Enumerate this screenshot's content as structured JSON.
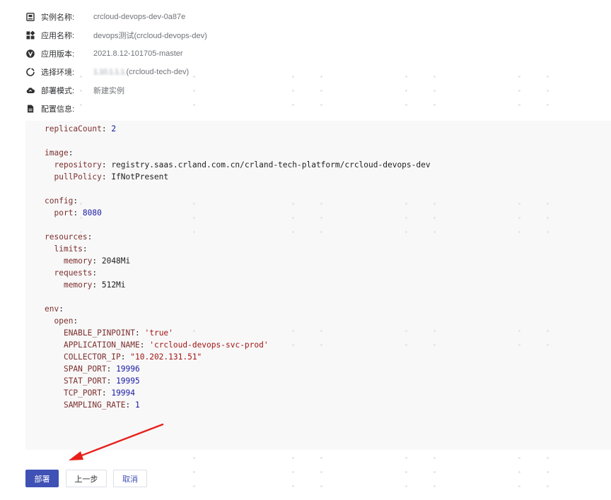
{
  "info": {
    "instance": {
      "label": "实例名称:",
      "value": "crcloud-devops-dev-0a87e",
      "icon": "instance-icon"
    },
    "app": {
      "label": "应用名称:",
      "value": "devops测试(crcloud-devops-dev)",
      "icon": "app-grid-icon"
    },
    "version": {
      "label": "应用版本:",
      "value": "2021.8.12-101705-master",
      "icon": "version-v-icon"
    },
    "env": {
      "label": "选择环境:",
      "value_blurred": "1.10.1.1.1.",
      "value": "(crcloud-tech-dev)",
      "icon": "environment-icon"
    },
    "mode": {
      "label": "部署模式:",
      "value": "新建实例",
      "icon": "cloud-icon"
    },
    "config": {
      "label": "配置信息:",
      "icon": "document-icon"
    }
  },
  "yaml": [
    [
      [
        "k",
        "replicaCount"
      ],
      [
        "p",
        ": "
      ],
      [
        "n",
        "2"
      ]
    ],
    [],
    [
      [
        "k",
        "image"
      ],
      [
        "p",
        ":"
      ]
    ],
    [
      [
        "p",
        "  "
      ],
      [
        "k",
        "repository"
      ],
      [
        "p",
        ": registry.saas.crland.com.cn/crland-tech-platform/crcloud-devops-dev"
      ]
    ],
    [
      [
        "p",
        "  "
      ],
      [
        "k",
        "pullPolicy"
      ],
      [
        "p",
        ": IfNotPresent"
      ]
    ],
    [],
    [
      [
        "k",
        "config"
      ],
      [
        "p",
        ":"
      ]
    ],
    [
      [
        "p",
        "  "
      ],
      [
        "k",
        "port"
      ],
      [
        "p",
        ": "
      ],
      [
        "n",
        "8080"
      ]
    ],
    [],
    [
      [
        "k",
        "resources"
      ],
      [
        "p",
        ":"
      ]
    ],
    [
      [
        "p",
        "  "
      ],
      [
        "k",
        "limits"
      ],
      [
        "p",
        ":"
      ]
    ],
    [
      [
        "p",
        "    "
      ],
      [
        "k",
        "memory"
      ],
      [
        "p",
        ": 2048Mi"
      ]
    ],
    [
      [
        "p",
        "  "
      ],
      [
        "k",
        "requests"
      ],
      [
        "p",
        ":"
      ]
    ],
    [
      [
        "p",
        "    "
      ],
      [
        "k",
        "memory"
      ],
      [
        "p",
        ": 512Mi"
      ]
    ],
    [],
    [
      [
        "k",
        "env"
      ],
      [
        "p",
        ":"
      ]
    ],
    [
      [
        "p",
        "  "
      ],
      [
        "k",
        "open"
      ],
      [
        "p",
        ":"
      ]
    ],
    [
      [
        "p",
        "    "
      ],
      [
        "k",
        "ENABLE_PINPOINT"
      ],
      [
        "p",
        ": "
      ],
      [
        "s",
        "'true'"
      ]
    ],
    [
      [
        "p",
        "    "
      ],
      [
        "k",
        "APPLICATION_NAME"
      ],
      [
        "p",
        ": "
      ],
      [
        "s",
        "'crcloud-devops-svc-prod'"
      ]
    ],
    [
      [
        "p",
        "    "
      ],
      [
        "k",
        "COLLECTOR_IP"
      ],
      [
        "p",
        ": "
      ],
      [
        "s",
        "\"10.202.131.51\""
      ]
    ],
    [
      [
        "p",
        "    "
      ],
      [
        "k",
        "SPAN_PORT"
      ],
      [
        "p",
        ": "
      ],
      [
        "n",
        "19996"
      ]
    ],
    [
      [
        "p",
        "    "
      ],
      [
        "k",
        "STAT_PORT"
      ],
      [
        "p",
        ": "
      ],
      [
        "n",
        "19995"
      ]
    ],
    [
      [
        "p",
        "    "
      ],
      [
        "k",
        "TCP_PORT"
      ],
      [
        "p",
        ": "
      ],
      [
        "n",
        "19994"
      ]
    ],
    [
      [
        "p",
        "    "
      ],
      [
        "k",
        "SAMPLING_RATE"
      ],
      [
        "p",
        ": "
      ],
      [
        "n",
        "1"
      ]
    ]
  ],
  "buttons": {
    "deploy": "部署",
    "prev": "上一步",
    "cancel": "取消"
  },
  "colors": {
    "primary": "#3f51b5",
    "arrow": "#e8201a",
    "code_bg": "#f8f8f8"
  }
}
